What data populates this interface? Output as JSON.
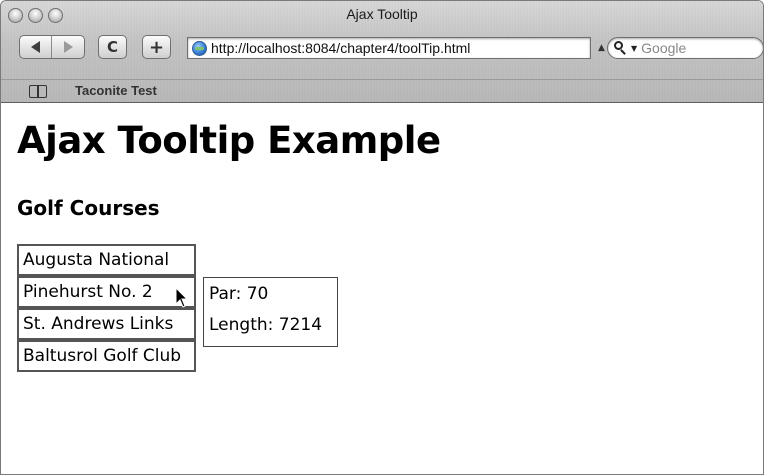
{
  "window": {
    "title": "Ajax Tooltip"
  },
  "toolbar": {
    "reload_label": "C",
    "add_label": "+",
    "url": "http://localhost:8084/chapter4/toolTip.html",
    "search_placeholder": "Google"
  },
  "bookmarks": {
    "items": [
      {
        "label": "Taconite Test"
      }
    ]
  },
  "page": {
    "title": "Ajax Tooltip Example",
    "section_title": "Golf Courses",
    "courses": [
      {
        "name": "Augusta National"
      },
      {
        "name": "Pinehurst No. 2"
      },
      {
        "name": "St. Andrews Links"
      },
      {
        "name": "Baltusrol Golf Club"
      }
    ]
  },
  "tooltip": {
    "par_line": "Par: 70",
    "length_line": "Length: 7214"
  },
  "colors": {
    "chrome_top": "#d8d8d8",
    "chrome_bottom": "#b8b8b8",
    "cell_border": "#555555",
    "page_background": "#ffffff"
  },
  "icons": [
    "close-window-icon",
    "minimize-window-icon",
    "zoom-window-icon",
    "back-arrow-icon",
    "forward-arrow-icon",
    "globe-icon",
    "search-icon",
    "bookmarks-book-icon",
    "mouse-pointer-icon"
  ]
}
